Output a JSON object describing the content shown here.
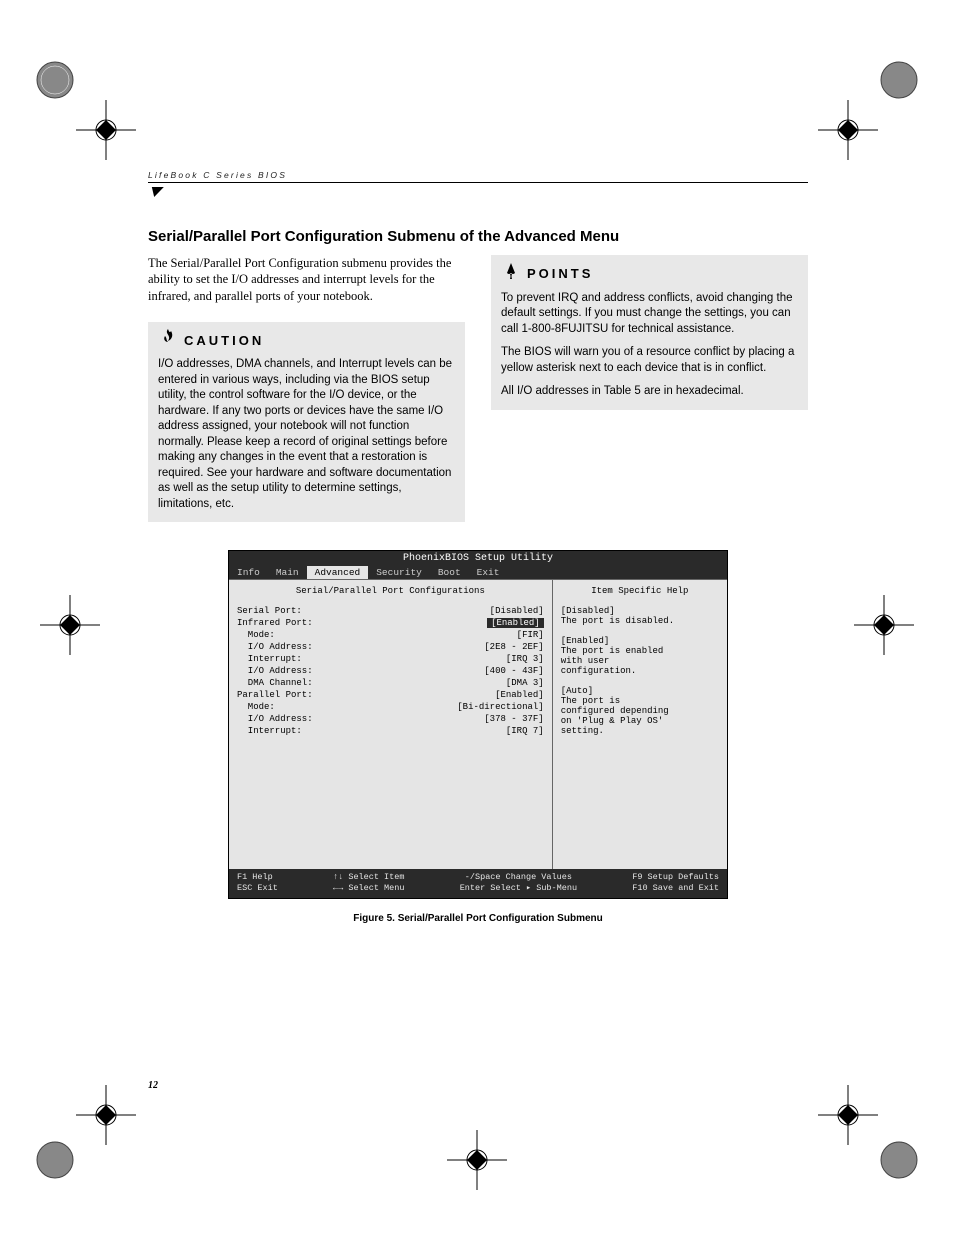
{
  "header": {
    "running": "LifeBook C Series BIOS"
  },
  "section": {
    "title": "Serial/Parallel Port Configuration Submenu of the Advanced Menu",
    "intro": "The Serial/Parallel Port Configuration submenu provides the ability to set the I/O addresses and interrupt levels for the infrared, and parallel ports of your notebook."
  },
  "caution": {
    "label": "CAUTION",
    "body": "I/O addresses, DMA channels, and Interrupt levels can be entered in various ways, including via the BIOS setup utility, the control software for the I/O device, or the hardware. If any two ports or devices have the same I/O address assigned, your notebook will not function normally. Please keep a record of original settings before making any changes in the event that a restoration is required. See your hardware and software documentation as well as the setup utility to determine settings, limitations, etc."
  },
  "points": {
    "label": "POINTS",
    "p1": "To prevent IRQ and address conflicts, avoid changing the default settings. If you must change the settings, you can call 1-800-8FUJITSU for technical assistance.",
    "p2": "The BIOS will warn you of a resource conflict by placing a yellow asterisk next to each device that is in conflict.",
    "p3": "All I/O addresses in Table 5 are in hexadecimal."
  },
  "bios": {
    "title": "PhoenixBIOS Setup Utility",
    "tabs": [
      "Info",
      "Main",
      "Advanced",
      "Security",
      "Boot",
      "Exit"
    ],
    "active_tab_index": 2,
    "subtitle": "Serial/Parallel Port Configurations",
    "help_heading": "Item Specific Help",
    "rows": [
      {
        "label": "Serial Port:",
        "value": "[Disabled]"
      },
      {
        "label": "Infrared Port:",
        "value": "[Enabled]",
        "highlight": true
      },
      {
        "label": "  Mode:",
        "value": "[FIR]"
      },
      {
        "label": "  I/O Address:",
        "value": "[2E8 - 2EF]"
      },
      {
        "label": "  Interrupt:",
        "value": "[IRQ 3]"
      },
      {
        "label": "  I/O Address:",
        "value": "[400 - 43F]"
      },
      {
        "label": "  DMA Channel:",
        "value": "[DMA 3]"
      },
      {
        "label": "Parallel Port:",
        "value": "[Enabled]"
      },
      {
        "label": "  Mode:",
        "value": "[Bi-directional]"
      },
      {
        "label": "  I/O Address:",
        "value": "[378 - 37F]"
      },
      {
        "label": "  Interrupt:",
        "value": "[IRQ 7]"
      }
    ],
    "help_lines": [
      "[Disabled]",
      "The port is disabled.",
      "",
      "[Enabled]",
      "The port is enabled",
      "with user",
      "configuration.",
      "",
      "[Auto]",
      "The port is",
      "configured depending",
      "on 'Plug & Play OS'",
      "setting."
    ],
    "footer": {
      "row1": {
        "a": "F1  Help",
        "b": "↑↓  Select Item",
        "c": "-/Space  Change Values",
        "d": "F9  Setup Defaults"
      },
      "row2": {
        "a": "ESC Exit",
        "b": "←→  Select Menu",
        "c": "Enter  Select ▸ Sub-Menu",
        "d": "F10 Save and Exit"
      }
    }
  },
  "figure_caption": "Figure 5.  Serial/Parallel Port Configuration Submenu",
  "page_number": "12"
}
